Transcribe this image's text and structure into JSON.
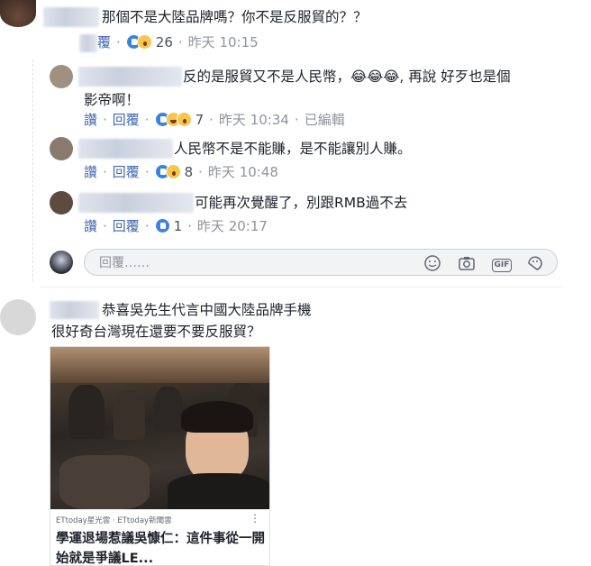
{
  "comments": [
    {
      "text": "那個不是大陸品牌嗎？你不是反服貿的？？",
      "actions": {
        "reply": "覆",
        "count": "26",
        "time": "昨天 10:15",
        "reactions": [
          "like",
          "wow"
        ]
      }
    },
    {
      "lines": [
        "反的是服貿又不是人民幣，😂😂😂, 再說 好歹也是個",
        "影帝啊！"
      ],
      "actions": {
        "read": "讚",
        "reply": "回覆",
        "count": "7",
        "time": "昨天 10:34",
        "edited": "已編輯",
        "reactions": [
          "like",
          "haha",
          "wow"
        ]
      }
    },
    {
      "text": "人民幣不是不能賺，是不能讓別人賺。",
      "actions": {
        "read": "讚",
        "reply": "回覆",
        "count": "8",
        "time": "昨天 10:48",
        "reactions": [
          "like",
          "wow"
        ]
      }
    },
    {
      "text": "可能再次覺醒了，別跟RMB過不去",
      "actions": {
        "read": "讚",
        "reply": "回覆",
        "count": "1",
        "time": "昨天 20:17",
        "reactions": [
          "like"
        ]
      }
    }
  ],
  "reply_box": {
    "placeholder": "回覆……",
    "icons": [
      "smiley-icon",
      "camera-icon",
      "gif-icon",
      "sticker-icon"
    ],
    "gif_label": "GIF"
  },
  "post": {
    "lines": [
      "恭喜吳先生代言中國大陸品牌手機",
      "很好奇台灣現在還要不要反服貿？"
    ],
    "card": {
      "source": "ETtoday星光雲 · ETtoday新聞雲",
      "menu": "⋮",
      "title": "學運退場惹議吳慷仁：這件事從一開始就是爭議LE..."
    }
  },
  "colors": {
    "link": "#4267b2",
    "meta": "#90949c",
    "like": "#3b82e0",
    "emoji": "#f7c64a"
  }
}
